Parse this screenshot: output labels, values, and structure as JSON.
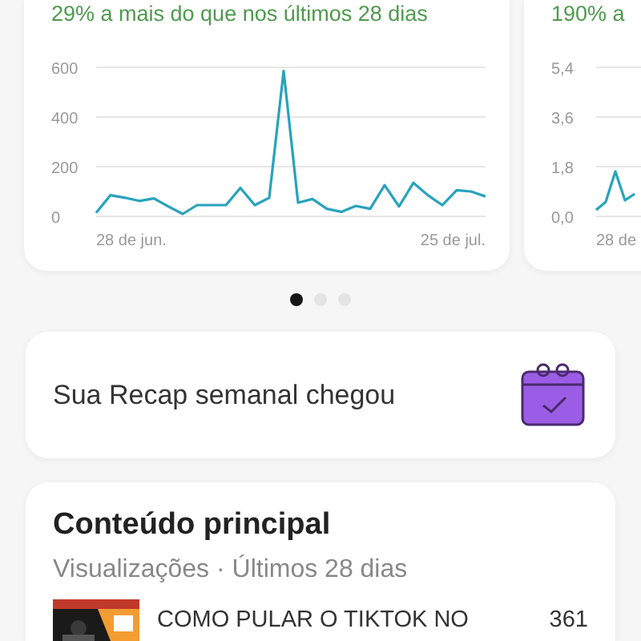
{
  "charts": [
    {
      "summary": "29% a mais do que nos últimos 28 dias",
      "x_labels": [
        "28 de jun.",
        "25 de jul."
      ],
      "chart_data": {
        "type": "line",
        "values": [
          15,
          85,
          75,
          62,
          72,
          40,
          10,
          45,
          45,
          45,
          115,
          45,
          75,
          585,
          55,
          70,
          30,
          18,
          42,
          30,
          125,
          40,
          135,
          85,
          45,
          105,
          100,
          80
        ],
        "ylim": [
          0,
          600
        ],
        "yticks": [
          0,
          200,
          400,
          600
        ]
      }
    },
    {
      "summary": "190% a",
      "x_labels": [
        "28 de"
      ],
      "y_labels": [
        "5,4",
        "3,6",
        "1,8",
        "0,0"
      ]
    }
  ],
  "pager": [
    {
      "selected": true
    },
    {
      "selected": false
    },
    {
      "selected": false
    }
  ],
  "recap": {
    "text": "Sua Recap semanal chegou"
  },
  "top_content": {
    "title": "Conteúdo principal",
    "subtitle": "Visualizações · Últimos 28 dias",
    "items": [
      {
        "title": "COMO PULAR O TIKTOK NO",
        "views": "361"
      }
    ]
  }
}
